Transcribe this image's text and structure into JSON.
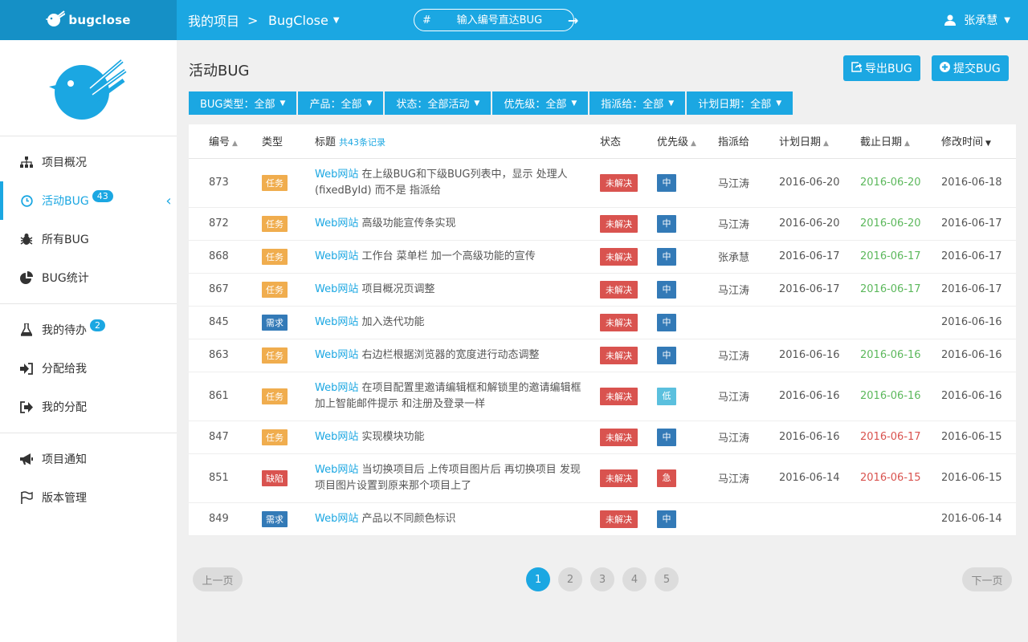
{
  "header": {
    "logo_text": "bugclose",
    "breadcrumb_projects": "我的项目",
    "breadcrumb_sep": ">",
    "current_project": "BugClose",
    "jump_hash": "#",
    "jump_placeholder": "输入编号直达BUG",
    "user_name": "张承慧"
  },
  "sidebar": {
    "groups": [
      [
        {
          "label": "项目概况",
          "icon": "sitemap-icon"
        },
        {
          "label": "活动BUG",
          "icon": "clock-icon",
          "badge": "43",
          "active": true
        },
        {
          "label": "所有BUG",
          "icon": "bug-icon"
        },
        {
          "label": "BUG统计",
          "icon": "pie-chart-icon"
        }
      ],
      [
        {
          "label": "我的待办",
          "icon": "flask-icon",
          "badge": "2"
        },
        {
          "label": "分配给我",
          "icon": "sign-in-icon"
        },
        {
          "label": "我的分配",
          "icon": "sign-out-icon"
        }
      ],
      [
        {
          "label": "项目通知",
          "icon": "bullhorn-icon"
        },
        {
          "label": "版本管理",
          "icon": "flag-icon"
        }
      ]
    ]
  },
  "main": {
    "title": "活动BUG",
    "export_label": "导出BUG",
    "submit_label": "提交BUG",
    "filters": [
      "BUG类型：全部",
      "产品：全部",
      "状态：全部活动",
      "优先级：全部",
      "指派给：全部",
      "计划日期：全部"
    ],
    "columns": {
      "id": "编号",
      "type": "类型",
      "title": "标题",
      "count": "共43条记录",
      "status": "状态",
      "priority": "优先级",
      "assignee": "指派给",
      "plan_date": "计划日期",
      "due_date": "截止日期",
      "modified": "修改时间"
    },
    "rows": [
      {
        "id": "873",
        "type": "任务",
        "site": "Web网站",
        "title": "在上级BUG和下级BUG列表中，显示 处理人(fixedById) 而不是 指派给",
        "status": "未解决",
        "priority": "中",
        "assignee": "马江涛",
        "plan": "2016-06-20",
        "due": "2016-06-20",
        "modified": "2016-06-18"
      },
      {
        "id": "872",
        "type": "任务",
        "site": "Web网站",
        "title": "高级功能宣传条实现",
        "status": "未解决",
        "priority": "中",
        "assignee": "马江涛",
        "plan": "2016-06-20",
        "due": "2016-06-20",
        "modified": "2016-06-17"
      },
      {
        "id": "868",
        "type": "任务",
        "site": "Web网站",
        "title": "工作台 菜单栏 加一个高级功能的宣传",
        "status": "未解决",
        "priority": "中",
        "assignee": "张承慧",
        "plan": "2016-06-17",
        "due": "2016-06-17",
        "modified": "2016-06-17"
      },
      {
        "id": "867",
        "type": "任务",
        "site": "Web网站",
        "title": "项目概况页调整",
        "status": "未解决",
        "priority": "中",
        "assignee": "马江涛",
        "plan": "2016-06-17",
        "due": "2016-06-17",
        "modified": "2016-06-17"
      },
      {
        "id": "845",
        "type": "需求",
        "site": "Web网站",
        "title": "加入迭代功能",
        "status": "未解决",
        "priority": "中",
        "assignee": "",
        "plan": "",
        "due": "",
        "modified": "2016-06-16"
      },
      {
        "id": "863",
        "type": "任务",
        "site": "Web网站",
        "title": "右边栏根据浏览器的宽度进行动态调整",
        "status": "未解决",
        "priority": "中",
        "assignee": "马江涛",
        "plan": "2016-06-16",
        "due": "2016-06-16",
        "modified": "2016-06-16"
      },
      {
        "id": "861",
        "type": "任务",
        "site": "Web网站",
        "title": "在项目配置里邀请编辑框和解锁里的邀请编辑框 加上智能邮件提示 和注册及登录一样",
        "status": "未解决",
        "priority": "低",
        "assignee": "马江涛",
        "plan": "2016-06-16",
        "due": "2016-06-16",
        "modified": "2016-06-16"
      },
      {
        "id": "847",
        "type": "任务",
        "site": "Web网站",
        "title": "实现模块功能",
        "status": "未解决",
        "priority": "中",
        "assignee": "马江涛",
        "plan": "2016-06-16",
        "due": "2016-06-17",
        "modified": "2016-06-15"
      },
      {
        "id": "851",
        "type": "缺陷",
        "site": "Web网站",
        "title": "当切换项目后 上传项目图片后 再切换项目 发现项目图片设置到原来那个项目上了",
        "status": "未解决",
        "priority": "急",
        "assignee": "马江涛",
        "plan": "2016-06-14",
        "due": "2016-06-15",
        "modified": "2016-06-15"
      },
      {
        "id": "849",
        "type": "需求",
        "site": "Web网站",
        "title": "产品以不同颜色标识",
        "status": "未解决",
        "priority": "中",
        "assignee": "",
        "plan": "",
        "due": "",
        "modified": "2016-06-14"
      }
    ],
    "pager": {
      "prev": "上一页",
      "next": "下一页",
      "pages": [
        "1",
        "2",
        "3",
        "4",
        "5"
      ],
      "current": "1"
    }
  },
  "colors": {
    "accent": "#1ba7e2",
    "logo_bg": "#1590c6",
    "task": "#f0ad4e",
    "requirement": "#337ab7",
    "defect": "#d9534f",
    "due_ok": "#5cb85c",
    "due_late": "#d9534f"
  }
}
